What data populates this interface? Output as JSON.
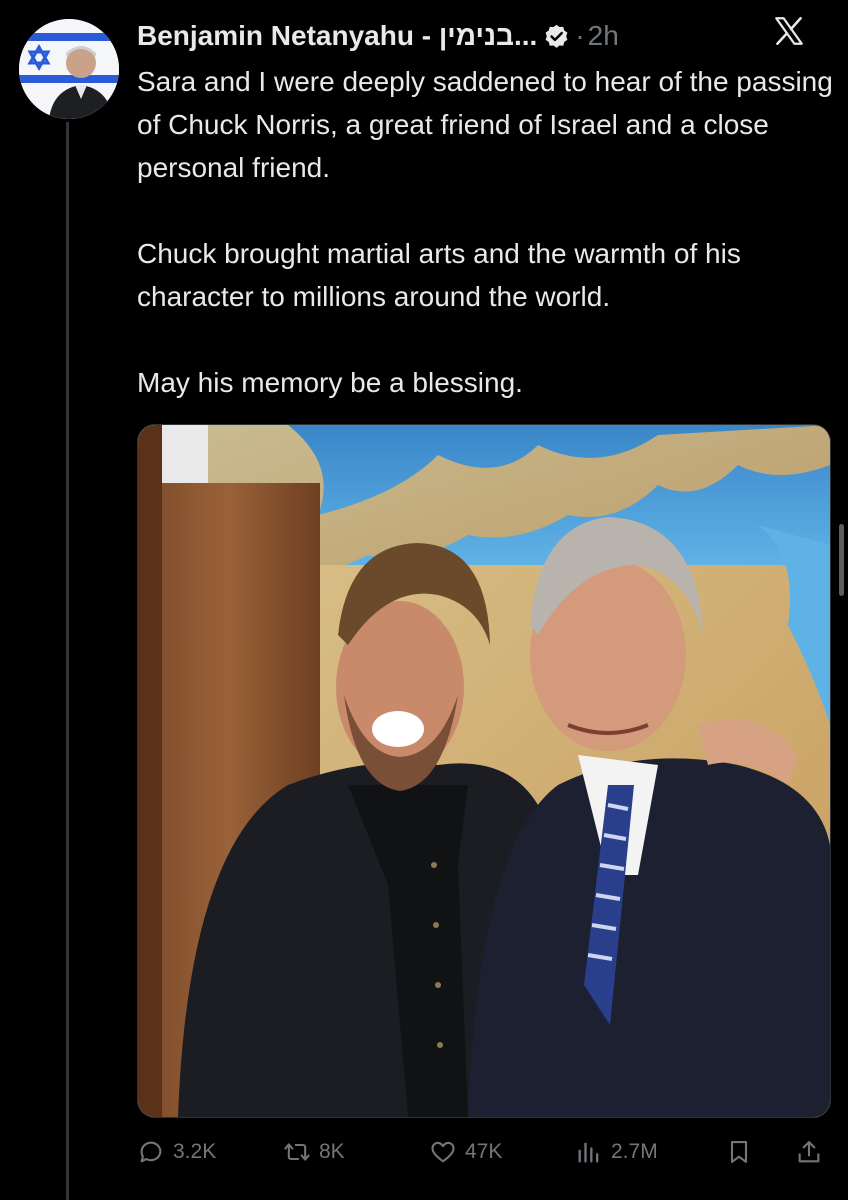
{
  "post": {
    "author": {
      "display_name": "Benjamin Netanyahu - בנימין...",
      "verified": true,
      "avatar_icon": "profile-photo-with-flag"
    },
    "separator": "·",
    "timestamp": "2h",
    "text_paragraphs": [
      "Sara and I were deeply saddened to hear of the passing of Chuck Norris, a great friend of Israel and a close personal friend.",
      "Chuck brought martial arts and the warmth of his character to millions around the world.",
      "May his memory be a blessing."
    ],
    "media": {
      "type": "photo",
      "icon": "photo-two-men-in-front-of-map"
    },
    "actions": {
      "replies": "3.2K",
      "reposts": "8K",
      "likes": "47K",
      "views": "2.7M"
    }
  },
  "colors": {
    "background": "#000000",
    "text": "#e7e9ea",
    "muted": "#71767b",
    "verified_badge": "#e7e9ea"
  },
  "icons": {
    "brand": "x-logo-icon",
    "reply": "speech-bubble-icon",
    "repost": "repost-arrows-icon",
    "like": "heart-icon",
    "views": "bar-chart-icon",
    "bookmark": "bookmark-icon",
    "share": "share-upload-icon",
    "verified": "verified-badge-icon"
  }
}
